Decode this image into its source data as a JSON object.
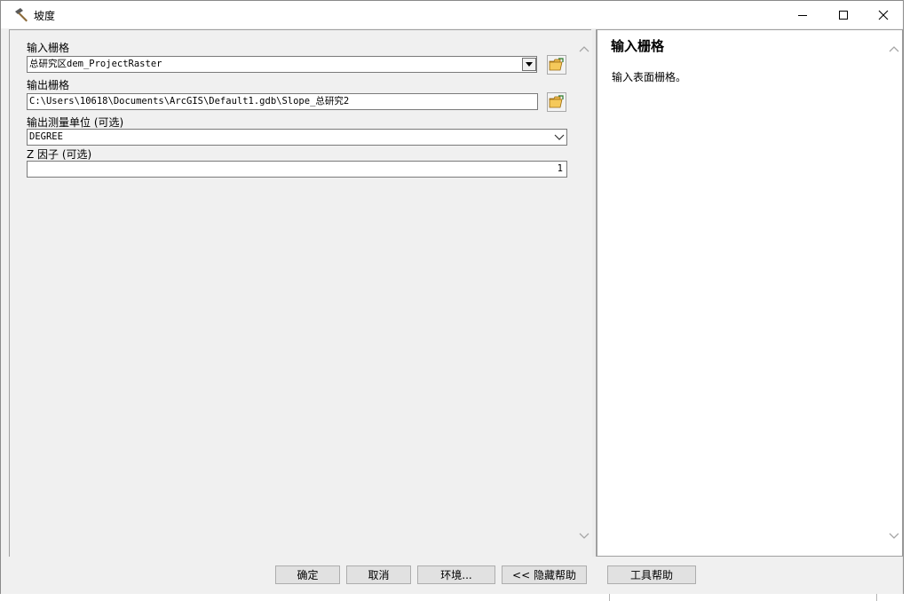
{
  "window": {
    "title": "坡度"
  },
  "form": {
    "input_raster": {
      "label": "输入栅格",
      "value": "总研究区dem_ProjectRaster"
    },
    "output_raster": {
      "label": "输出栅格",
      "value": "C:\\Users\\10618\\Documents\\ArcGIS\\Default1.gdb\\Slope_总研究2"
    },
    "measurement": {
      "label": "输出测量单位 (可选)",
      "value": "DEGREE"
    },
    "z_factor": {
      "label": "Z 因子 (可选)",
      "value": "1"
    }
  },
  "help": {
    "title": "输入栅格",
    "body": "输入表面栅格。"
  },
  "buttons": {
    "ok": "确定",
    "cancel": "取消",
    "environments": "环境...",
    "hide_help": "<< 隐藏帮助",
    "tool_help": "工具帮助"
  },
  "icons": {
    "title": "hammer-icon",
    "browse": "folder-open-icon"
  }
}
